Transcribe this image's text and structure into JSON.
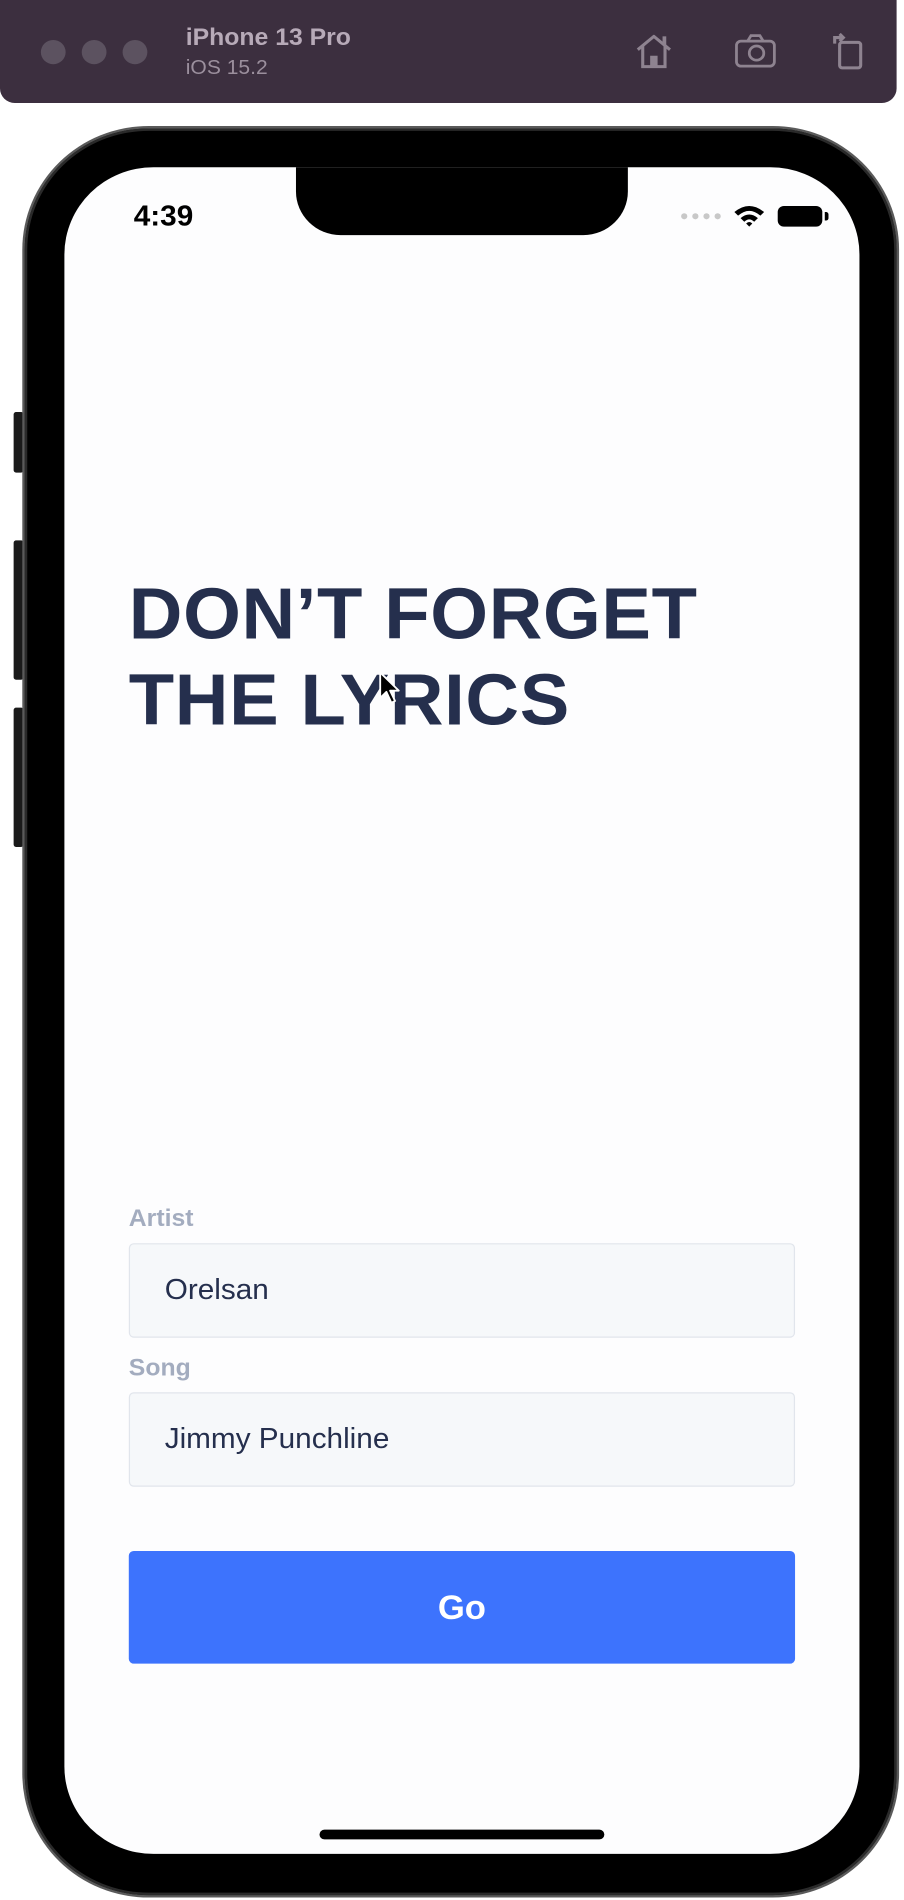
{
  "simulator": {
    "device_name": "iPhone 13 Pro",
    "os_version": "iOS 15.2",
    "icons": [
      "home-icon",
      "screenshot-icon",
      "rotate-icon"
    ]
  },
  "status_bar": {
    "time": "4:39",
    "icons": [
      "signal-dots-icon",
      "wifi-icon",
      "battery-icon"
    ]
  },
  "app": {
    "headline_line1": "DON’T FORGET",
    "headline_line2": "THE LYRICS",
    "artist_label": "Artist",
    "artist_value": "Orelsan",
    "song_label": "Song",
    "song_value": "Jimmy Punchline",
    "go_label": "Go"
  },
  "colors": {
    "simulator_bar": "#3c2f3f",
    "headline": "#252f4d",
    "label": "#a3acbf",
    "field_bg": "#f6f8fa",
    "button": "#3d73fd"
  }
}
